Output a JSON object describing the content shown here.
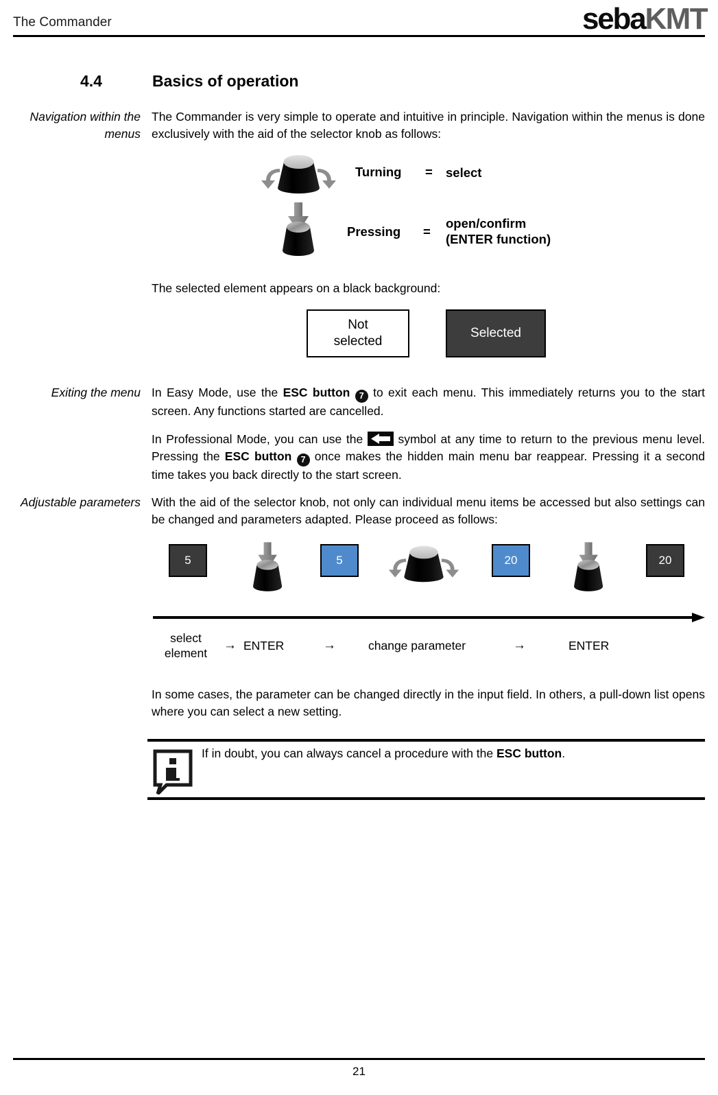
{
  "header": {
    "title": "The Commander",
    "logo_primary": "seba",
    "logo_secondary": "KMT"
  },
  "section": {
    "number": "4.4",
    "title": "Basics of operation"
  },
  "navigation_block": {
    "margin_note": "Navigation within the menus",
    "paragraph": "The Commander is very simple to operate and intuitive in principle. Navigation within the menus is done exclusively with the aid of the selector knob as follows:"
  },
  "knob_legend": {
    "turning_label": "Turning",
    "turning_equals": "=",
    "turning_value": "select",
    "pressing_label": "Pressing",
    "pressing_equals": "=",
    "pressing_value_line1": "open/confirm",
    "pressing_value_line2": "(ENTER function)"
  },
  "selection_demo": {
    "intro": "The selected element appears on a black background:",
    "not_selected_line1": "Not",
    "not_selected_line2": "selected",
    "selected_label": "Selected",
    "selected_bg": "#3d3d3d",
    "unselected_bg": "#ffffff"
  },
  "exiting_block": {
    "margin_note": "Exiting the menu",
    "easy_mode_part1": "In Easy Mode, use the ",
    "easy_mode_bold": "ESC button",
    "esc_key_number": "7",
    "easy_mode_part2": " to exit each menu. This immediately returns you to the start screen. Any functions started are cancelled.",
    "pro_mode_part1": "In Professional Mode, you can use the ",
    "pro_mode_part2": " symbol at any time to return to the previous menu level. Pressing the ",
    "pro_mode_bold": "ESC button",
    "pro_mode_part3": " once makes the hidden main menu bar reappear. Pressing it a second time takes you back directly to the start screen."
  },
  "parameters_block": {
    "margin_note": "Adjustable parameters",
    "paragraph": "With the aid of the selector knob, not only can individual menu items be accessed but also settings can be changed and parameters adapted. Please proceed as follows:",
    "closing_paragraph": "In some cases, the parameter can be changed directly in the input field. In others, a pull-down list opens where you can select a new setting."
  },
  "flow": {
    "boxes": [
      {
        "value": "5",
        "style": "dark"
      },
      {
        "value": "5",
        "style": "blue"
      },
      {
        "value": "20",
        "style": "blue"
      },
      {
        "value": "20",
        "style": "dark"
      }
    ],
    "dark_color": "#3a3a3a",
    "blue_color": "#4f8bcc",
    "steps": [
      {
        "label_line1": "select",
        "label_line2": "element"
      },
      {
        "label_line1": "ENTER",
        "label_line2": ""
      },
      {
        "label_line1": "change parameter",
        "label_line2": ""
      },
      {
        "label_line1": "ENTER",
        "label_line2": ""
      }
    ],
    "arrow_char": "→"
  },
  "note": {
    "icon_letter": "i",
    "text_part1": "If in doubt, you can always cancel a procedure with the ",
    "text_bold": "ESC button",
    "text_part2": "."
  },
  "footer": {
    "page_number": "21"
  }
}
